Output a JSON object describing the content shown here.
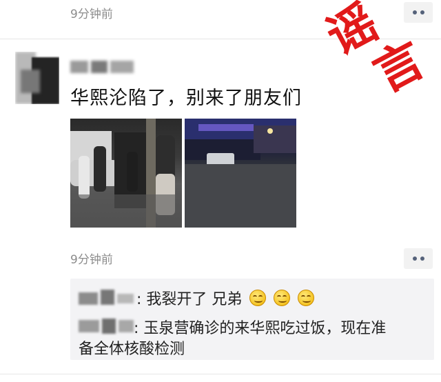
{
  "top": {
    "time": "9分钟前"
  },
  "post": {
    "text": "华熙沦陷了，别来了朋友们",
    "time": "9分钟前",
    "photos": [
      {
        "icon": "night-street-photo"
      },
      {
        "icon": "night-building-photo"
      }
    ]
  },
  "comments": {
    "line1": {
      "text": ": 我裂开了 兄弟",
      "emoji_count": 3,
      "emoji_icon": "smile-emoji-icon"
    },
    "line2": {
      "text_a": ": 玉泉营确诊的来华熙吃过饭，现在准",
      "text_b": "备全体核酸检测"
    }
  },
  "stamp": {
    "char1": "谣",
    "char2": "言"
  },
  "colors": {
    "stamp": "#e11a1a",
    "meta": "#8c8c8c",
    "more_dots": "#55627a"
  }
}
